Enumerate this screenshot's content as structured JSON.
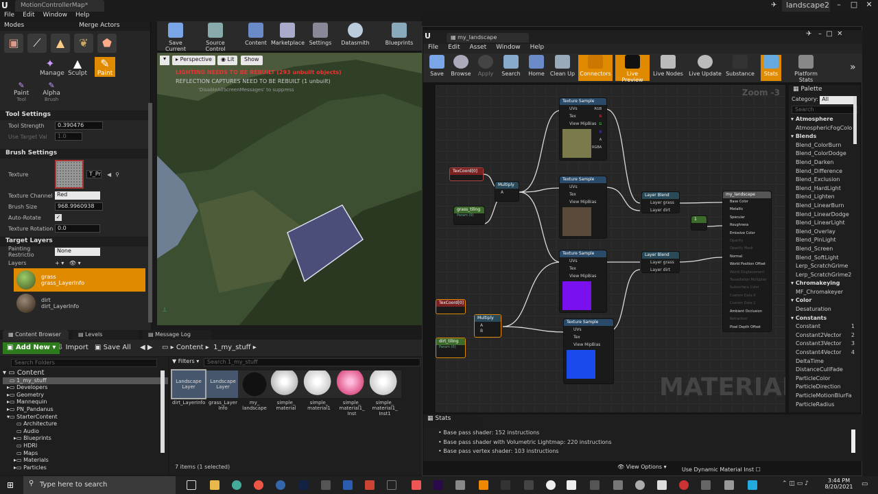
{
  "window": {
    "tab_title": "MotionControllerMap*",
    "project": "landscape2"
  },
  "menu": [
    "File",
    "Edit",
    "Window",
    "Help"
  ],
  "modes": {
    "tab": "Modes",
    "tab2": "Merge Actors",
    "tools": [
      "Manage",
      "Sculpt",
      "Paint"
    ],
    "subtools": [
      {
        "label": "Paint",
        "sub": "Tool"
      },
      {
        "label": "Alpha",
        "sub": "Brush"
      }
    ]
  },
  "tool_settings": {
    "title": "Tool Settings",
    "strength_label": "Tool Strength",
    "strength": "0.390476",
    "target_label": "Use Target Val",
    "target": "1.0"
  },
  "brush_settings": {
    "title": "Brush Settings",
    "texture_label": "Texture",
    "texture_value": "T_Pr",
    "channel_label": "Texture Channel",
    "channel": "Red",
    "size_label": "Brush Size",
    "size": "968.9960938",
    "autorotate_label": "Auto-Rotate",
    "rotation_label": "Texture Rotation",
    "rotation": "0.0"
  },
  "target_layers": {
    "title": "Target Layers",
    "restriction_label": "Painting Restrictio",
    "restriction": "None",
    "layers_label": "Layers",
    "layers": [
      {
        "name": "grass",
        "info": "grass_LayerInfo"
      },
      {
        "name": "dirt",
        "info": "dirt_LayerInfo"
      }
    ]
  },
  "level_toolbar": [
    "Save Current",
    "Source Control",
    "Content",
    "Marketplace",
    "Settings",
    "Datasmith",
    "Blueprints"
  ],
  "viewport": {
    "perspective": "Perspective",
    "lit": "Lit",
    "show": "Show",
    "warning": "LIGHTING NEEDS TO BE REBUILT (293 unbuilt objects)",
    "warning2": "REFLECTION CAPTURES NEED TO BE REBUILT (1 unbuilt)",
    "warning3": "'DisableAllScreenMessages' to suppress"
  },
  "content_browser": {
    "tabs": [
      "Content Browser",
      "Levels",
      "Message Log"
    ],
    "add_new": "Add New",
    "import": "Import",
    "save_all": "Save All",
    "path": [
      "Content",
      "1_my_stuff"
    ],
    "search_folders": "Search Folders",
    "filters": "Filters",
    "search_assets": "Search 1_my_stuff",
    "tree": [
      "Content",
      "1_my_stuff",
      "Developers",
      "Geometry",
      "Mannequin",
      "PN_Pandanus",
      "StarterContent",
      "Architecture",
      "Audio",
      "Blueprints",
      "HDRI",
      "Maps",
      "Materials",
      "Particles"
    ],
    "assets": [
      {
        "thumb": "Landscape Layer",
        "name": "dirt_LayerInfo"
      },
      {
        "thumb": "Landscape Layer",
        "name": "grass_Layer Info"
      },
      {
        "thumb": "",
        "name": "my_ landscape"
      },
      {
        "thumb": "",
        "name": "simple_ material"
      },
      {
        "thumb": "",
        "name": "simple_ material1"
      },
      {
        "thumb": "",
        "name": "simple_ material1_ Inst"
      },
      {
        "thumb": "",
        "name": "simple_ material1_ Inst1"
      }
    ],
    "status": "7 items (1 selected)"
  },
  "material_editor": {
    "tab": "my_landscape",
    "menu": [
      "File",
      "Edit",
      "Asset",
      "Window",
      "Help"
    ],
    "toolbar": [
      "Save",
      "Browse",
      "Apply",
      "Search",
      "Home",
      "Clean Up",
      "Connectors",
      "Live Preview",
      "Live Nodes",
      "Live Update",
      "Substance",
      "Stats",
      "Platform Stats"
    ],
    "zoom": "Zoom -3",
    "watermark": "MATERIAL",
    "nodes": {
      "texture_sample": "Texture Sample",
      "multiply": "Multiply",
      "layer_blend": "Layer Blend",
      "texcoord": "TexCoord[0]",
      "grass_tiling": "grass_tiling",
      "dirt_tiling": "dirt_tiling",
      "param": "Param (0)",
      "const": "1",
      "result": "my_landscape",
      "ts_inputs": [
        "UVs",
        "Tex",
        "View MipBias"
      ],
      "ts_outputs": [
        "RGB",
        "R",
        "G",
        "B",
        "A",
        "RGBA"
      ],
      "mul_inputs": [
        "A",
        "B"
      ],
      "lb_inputs": [
        "Layer grass",
        "Layer dirt"
      ],
      "result_pins": [
        "Base Color",
        "Metallic",
        "Specular",
        "Roughness",
        "Emissive Color",
        "Opacity",
        "Opacity Mask",
        "Normal",
        "World Position Offset",
        "World Displacement",
        "Tessellation Multiplier",
        "Subsurface Color",
        "Custom Data 0",
        "Custom Data 1",
        "Ambient Occlusion",
        "Refraction",
        "Pixel Depth Offset"
      ]
    },
    "palette": {
      "title": "Palette",
      "category_label": "Category:",
      "category": "All",
      "search": "Search",
      "items": [
        {
          "t": "Atmosphere",
          "c": true
        },
        {
          "t": "AtmosphericFogColo"
        },
        {
          "t": "Blends",
          "c": true
        },
        {
          "t": "Blend_ColorBurn"
        },
        {
          "t": "Blend_ColorDodge"
        },
        {
          "t": "Blend_Darken"
        },
        {
          "t": "Blend_Difference"
        },
        {
          "t": "Blend_Exclusion"
        },
        {
          "t": "Blend_HardLight"
        },
        {
          "t": "Blend_Lighten"
        },
        {
          "t": "Blend_LinearBurn"
        },
        {
          "t": "Blend_LinearDodge"
        },
        {
          "t": "Blend_LinearLight"
        },
        {
          "t": "Blend_Overlay"
        },
        {
          "t": "Blend_PinLight"
        },
        {
          "t": "Blend_Screen"
        },
        {
          "t": "Blend_SoftLight"
        },
        {
          "t": "Lerp_ScratchGrime"
        },
        {
          "t": "Lerp_ScratchGrime2"
        },
        {
          "t": "Chromakeying",
          "c": true
        },
        {
          "t": "MF_Chromakeyer"
        },
        {
          "t": "Color",
          "c": true
        },
        {
          "t": "Desaturation"
        },
        {
          "t": "Constants",
          "c": true
        },
        {
          "t": "Constant",
          "k": "1"
        },
        {
          "t": "Constant2Vector",
          "k": "2"
        },
        {
          "t": "Constant3Vector",
          "k": "3"
        },
        {
          "t": "Constant4Vector",
          "k": "4"
        },
        {
          "t": "DeltaTime"
        },
        {
          "t": "DistanceCullFade"
        },
        {
          "t": "ParticleColor"
        },
        {
          "t": "ParticleDirection"
        },
        {
          "t": "ParticleMotionBlurFa"
        },
        {
          "t": "ParticleRadius"
        }
      ]
    },
    "stats": {
      "title": "Stats",
      "lines": [
        "Base pass shader: 152 instructions",
        "Base pass shader with Volumetric Lightmap: 220 instructions",
        "Base pass vertex shader: 103 instructions"
      ]
    },
    "view_options": "View Options",
    "dynamic_inst": "Use Dynamic Material Inst"
  },
  "taskbar": {
    "search": "Type here to search",
    "time": "3:44 PM",
    "date": "8/20/2021"
  },
  "colors": {
    "accent": "#e08a00",
    "green": "#2d7b1c",
    "warning": "#ee3333"
  }
}
